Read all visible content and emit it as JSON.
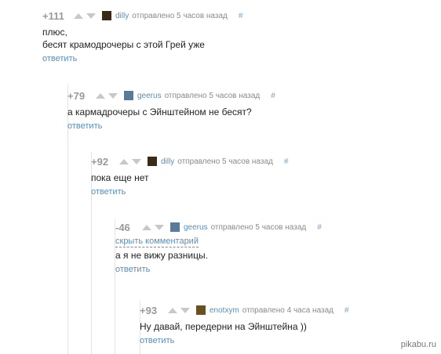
{
  "comments": [
    {
      "rating": "+111",
      "user": "dilly",
      "posted": "отправлено 5 часов назад",
      "hash": "#",
      "lines": [
        "плюс,",
        "бесят крамодрочеры с этой Грей уже"
      ],
      "reply": "ответить",
      "avatar_color": "#3a2a18"
    },
    {
      "rating": "+79",
      "user": "geerus",
      "posted": "отправлено 5 часов назад",
      "hash": "#",
      "lines": [
        "а кармадрочеры с Эйнштейном не бесят?"
      ],
      "reply": "ответить",
      "avatar_color": "#5a7a9a"
    },
    {
      "rating": "+92",
      "user": "dilly",
      "posted": "отправлено 5 часов назад",
      "hash": "#",
      "lines": [
        "пока еще нет"
      ],
      "reply": "ответить",
      "avatar_color": "#3a2a18"
    },
    {
      "rating": "-46",
      "user": "geerus",
      "posted": "отправлено 5 часов назад",
      "hash": "#",
      "hide_label": "скрыть комментарий",
      "lines": [
        "а я не вижу разницы."
      ],
      "reply": "ответить",
      "avatar_color": "#5a7a9a"
    },
    {
      "rating": "+93",
      "user": "enotxym",
      "posted": "отправлено 4 часа назад",
      "hash": "#",
      "lines": [
        "Ну давай, передерни на Эйнштейна ))"
      ],
      "reply": "ответить",
      "avatar_color": "#6a5020"
    }
  ],
  "logo": "pikabu.ru"
}
